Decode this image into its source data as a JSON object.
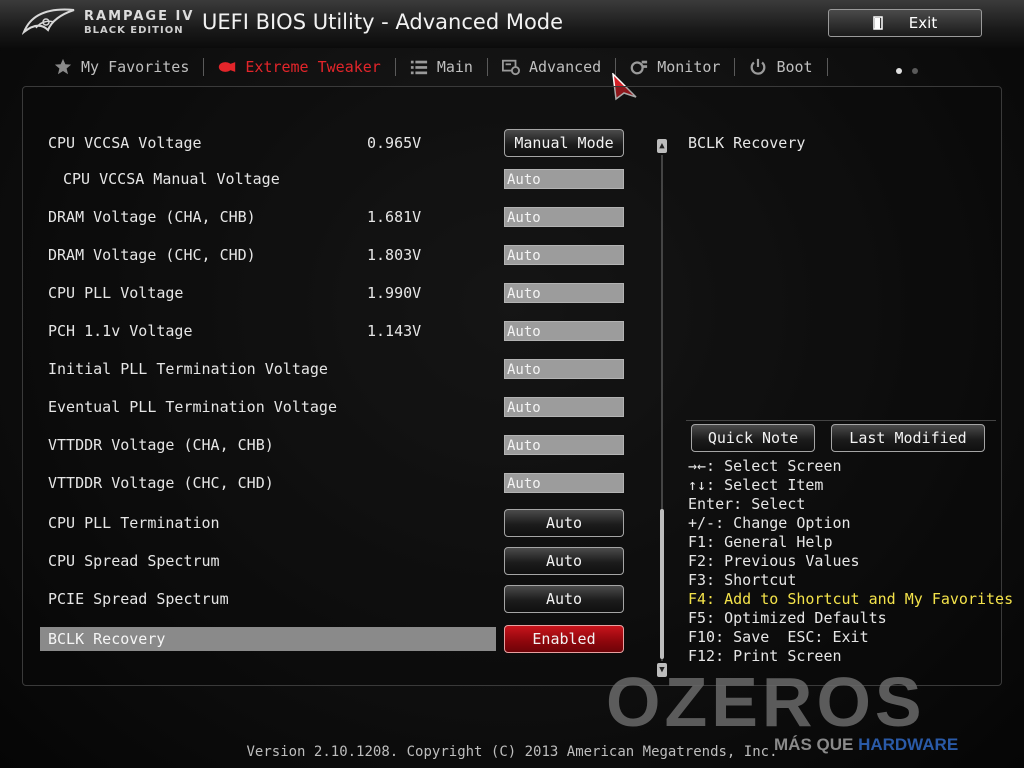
{
  "header": {
    "brand_line1": "RAMPAGE IV",
    "brand_line2": "BLACK EDITION",
    "title": "UEFI BIOS Utility - Advanced Mode",
    "exit_label": "Exit"
  },
  "nav": {
    "tabs": [
      {
        "label": "My Favorites",
        "icon": "star-icon",
        "active": false
      },
      {
        "label": "Extreme Tweaker",
        "icon": "tweaker-icon",
        "active": true
      },
      {
        "label": "Main",
        "icon": "list-icon",
        "active": false
      },
      {
        "label": "Advanced",
        "icon": "advanced-icon",
        "active": false
      },
      {
        "label": "Monitor",
        "icon": "monitor-icon",
        "active": false
      },
      {
        "label": "Boot",
        "icon": "power-icon",
        "active": false
      }
    ]
  },
  "settings": [
    {
      "label": "CPU VCCSA Voltage",
      "value": "0.965V",
      "control": "Manual Mode",
      "kind": "button"
    },
    {
      "label": "CPU VCCSA Manual Voltage",
      "value": "",
      "control": "Auto",
      "kind": "field",
      "indent": true
    },
    {
      "label": "DRAM Voltage (CHA, CHB)",
      "value": "1.681V",
      "control": "Auto",
      "kind": "field"
    },
    {
      "label": "DRAM Voltage (CHC, CHD)",
      "value": "1.803V",
      "control": "Auto",
      "kind": "field"
    },
    {
      "label": "CPU PLL Voltage",
      "value": "1.990V",
      "control": "Auto",
      "kind": "field"
    },
    {
      "label": "PCH 1.1v Voltage",
      "value": "1.143V",
      "control": "Auto",
      "kind": "field"
    },
    {
      "label": "Initial PLL Termination Voltage",
      "value": "",
      "control": "Auto",
      "kind": "field"
    },
    {
      "label": "Eventual PLL Termination Voltage",
      "value": "",
      "control": "Auto",
      "kind": "field"
    },
    {
      "label": "VTTDDR Voltage (CHA, CHB)",
      "value": "",
      "control": "Auto",
      "kind": "field"
    },
    {
      "label": "VTTDDR Voltage (CHC, CHD)",
      "value": "",
      "control": "Auto",
      "kind": "field"
    },
    {
      "label": "CPU PLL Termination",
      "value": "",
      "control": "Auto",
      "kind": "button"
    },
    {
      "label": "CPU Spread Spectrum",
      "value": "",
      "control": "Auto",
      "kind": "button"
    },
    {
      "label": "PCIE Spread Spectrum",
      "value": "",
      "control": "Auto",
      "kind": "button"
    },
    {
      "label": "BCLK Recovery",
      "value": "",
      "control": "Enabled",
      "kind": "button-red",
      "selected": true
    }
  ],
  "help": {
    "title": "BCLK Recovery",
    "quick_note": "Quick Note",
    "last_modified": "Last Modified",
    "keys": [
      "→←: Select Screen",
      "↑↓: Select Item",
      "Enter: Select",
      "+/-: Change Option",
      "F1: General Help",
      "F2: Previous Values",
      "F3: Shortcut",
      "F4: Add to Shortcut and My Favorites",
      "F5: Optimized Defaults",
      "F10: Save  ESC: Exit",
      "F12: Print Screen"
    ],
    "highlight_key_index": 7
  },
  "watermark": {
    "text": "OZEROS",
    "tagline_prefix": "MÁS QUE ",
    "tagline_suffix": "HARDWARE"
  },
  "footer": "Version 2.10.1208. Copyright (C) 2013 American Megatrends, Inc.",
  "colors": {
    "accent": "#e3252a",
    "highlight_text": "#f3e24a",
    "field_bg": "#9c9c9c"
  }
}
